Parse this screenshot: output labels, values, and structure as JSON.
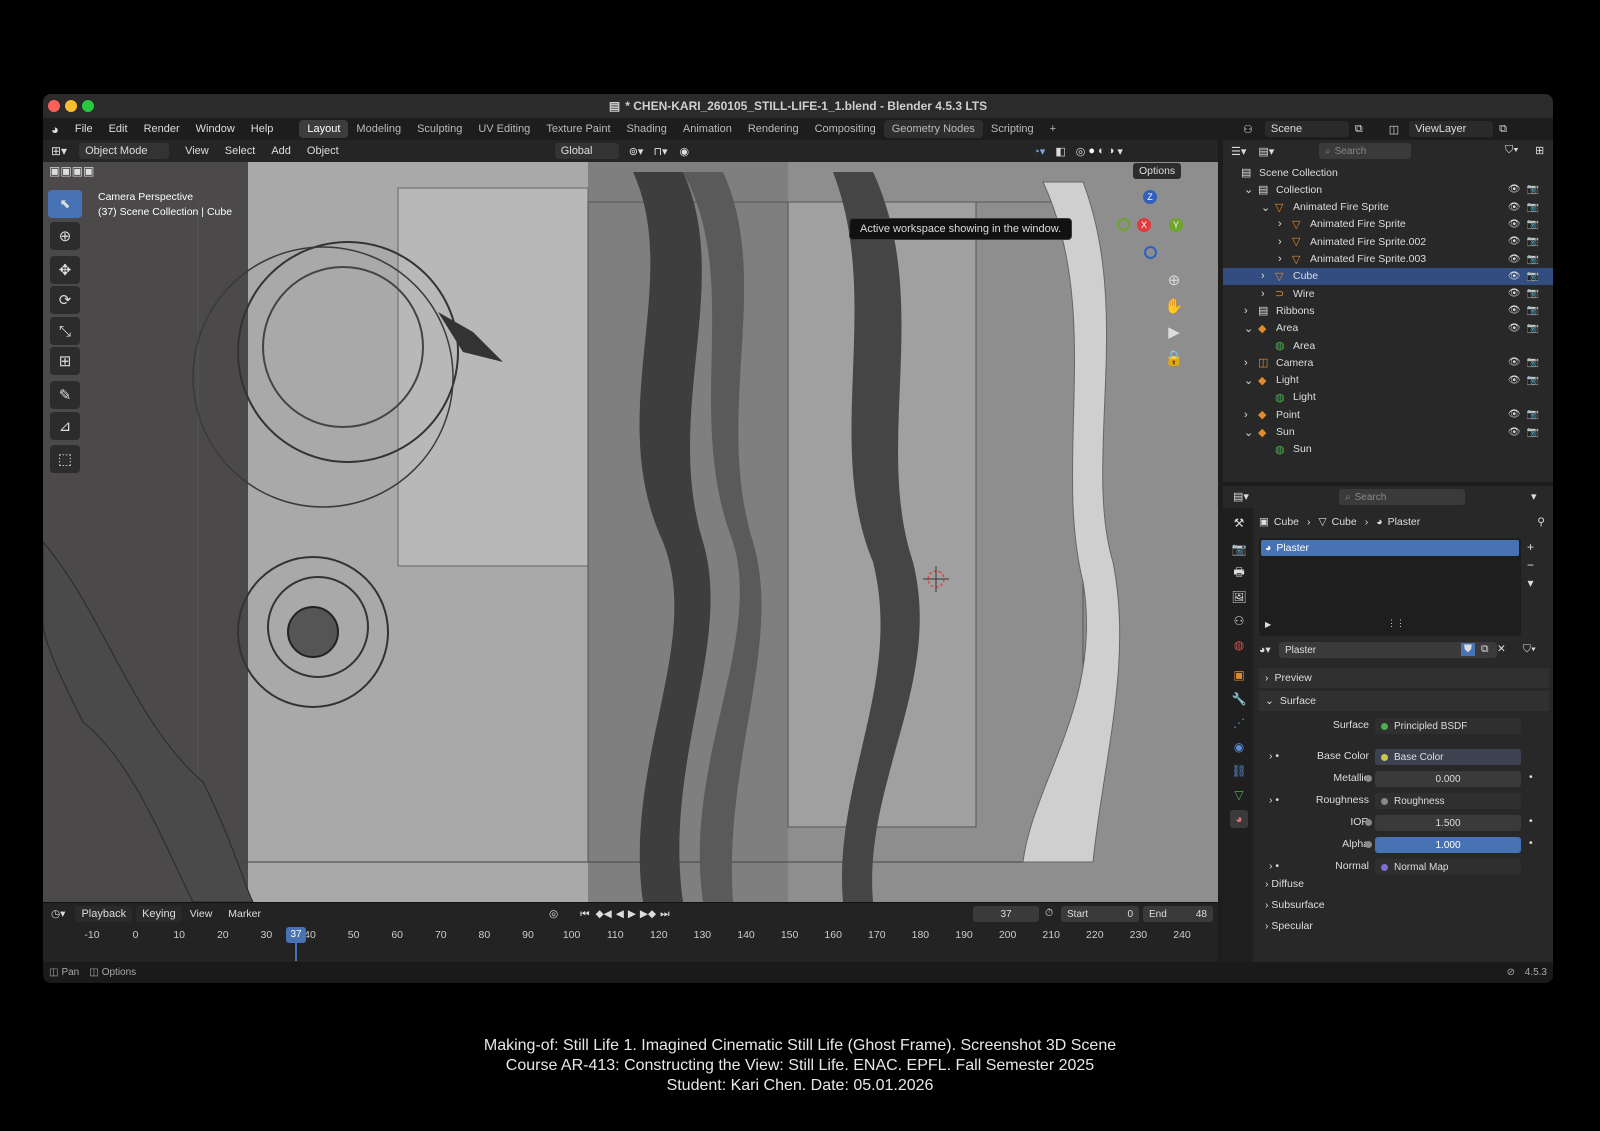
{
  "window": {
    "title": "* CHEN-KARI_260105_STILL-LIFE-1_1.blend - Blender 4.5.3 LTS"
  },
  "menu": [
    "File",
    "Edit",
    "Render",
    "Window",
    "Help"
  ],
  "workspaces": [
    "Layout",
    "Modeling",
    "Sculpting",
    "UV Editing",
    "Texture Paint",
    "Shading",
    "Animation",
    "Rendering",
    "Compositing",
    "Geometry Nodes",
    "Scripting"
  ],
  "topright": {
    "scene": "Scene",
    "viewlayer": "ViewLayer"
  },
  "viewport_header": {
    "mode": "Object Mode",
    "view": "View",
    "select": "Select",
    "add": "Add",
    "object": "Object",
    "orientation": "Global",
    "options": "Options"
  },
  "tooltip": "Active workspace showing in the window.",
  "overlay": {
    "line1": "Camera Perspective",
    "line2": "(37) Scene Collection | Cube"
  },
  "gizmo": {
    "z": "Z",
    "x": "X",
    "y": "Y"
  },
  "timeline": {
    "playback": "Playback",
    "keying": "Keying",
    "view": "View",
    "marker": "Marker",
    "current": "37",
    "start_label": "Start",
    "start": "0",
    "end_label": "End",
    "end": "48",
    "ticks": [
      "-10",
      "0",
      "10",
      "20",
      "30",
      "40",
      "50",
      "60",
      "70",
      "80",
      "90",
      "100",
      "110",
      "120",
      "130",
      "140",
      "150",
      "160",
      "170",
      "180",
      "190",
      "200",
      "210",
      "220",
      "230",
      "240"
    ],
    "frame_badge": "37"
  },
  "status": {
    "pan": "Pan",
    "options": "Options",
    "version": "4.5.3"
  },
  "outliner": {
    "search": "Search",
    "rows": [
      {
        "label": "Scene Collection",
        "indent": 0
      },
      {
        "label": "Collection",
        "indent": 1
      },
      {
        "label": "Animated Fire Sprite",
        "indent": 2
      },
      {
        "label": "Animated Fire Sprite",
        "indent": 3
      },
      {
        "label": "Animated Fire Sprite.002",
        "indent": 3
      },
      {
        "label": "Animated Fire Sprite.003",
        "indent": 3
      },
      {
        "label": "Cube",
        "indent": 2,
        "selected": true
      },
      {
        "label": "Wire",
        "indent": 2
      },
      {
        "label": "Ribbons",
        "indent": 1
      },
      {
        "label": "Area",
        "indent": 1
      },
      {
        "label": "Area",
        "indent": 2
      },
      {
        "label": "Camera",
        "indent": 1
      },
      {
        "label": "Light",
        "indent": 1
      },
      {
        "label": "Light",
        "indent": 2
      },
      {
        "label": "Point",
        "indent": 1
      },
      {
        "label": "Sun",
        "indent": 1
      },
      {
        "label": "Sun",
        "indent": 2
      }
    ]
  },
  "properties": {
    "search": "Search",
    "breadcrumb": [
      "Cube",
      "Cube",
      "Plaster"
    ],
    "slot": "Plaster",
    "material": "Plaster",
    "preview": "Preview",
    "surface_panel": "Surface",
    "fields": [
      {
        "label": "Surface",
        "value": "Principled BSDF",
        "dot": "#4caf50"
      },
      {
        "label": "Base Color",
        "value": "Base Color",
        "dot": "#c8c84a"
      },
      {
        "label": "Metallic",
        "value": "0.000",
        "dot": "#888"
      },
      {
        "label": "Roughness",
        "value": "Roughness",
        "dot": "#888"
      },
      {
        "label": "IOR",
        "value": "1.500",
        "dot": "#888"
      },
      {
        "label": "Alpha",
        "value": "1.000",
        "dot": "#888"
      },
      {
        "label": "Normal",
        "value": "Normal Map",
        "dot": "#7b6fd6"
      }
    ],
    "subpanels": [
      "Diffuse",
      "Subsurface",
      "Specular"
    ]
  },
  "caption": [
    "Making-of: Still Life 1. Imagined Cinematic Still Life (Ghost Frame). Screenshot 3D Scene",
    "Course AR-413: Constructing the View: Still Life. ENAC. EPFL. Fall Semester 2025",
    "Student: Kari Chen. Date: 05.01.2026"
  ]
}
